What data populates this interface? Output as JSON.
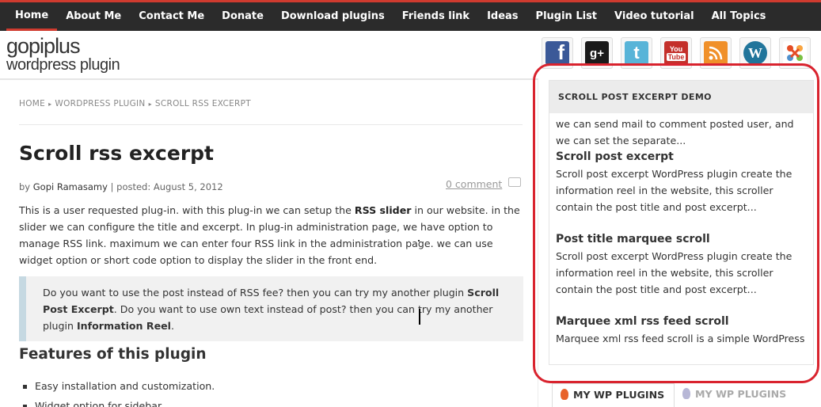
{
  "nav": {
    "items": [
      "Home",
      "About Me",
      "Contact Me",
      "Donate",
      "Download plugins",
      "Friends link",
      "Ideas",
      "Plugin List",
      "Video tutorial",
      "All Topics"
    ]
  },
  "logo": {
    "line1": "gopiplus",
    "line2": "wordpress plugin"
  },
  "social": {
    "icons": [
      "facebook-icon",
      "google-plus-icon",
      "twitter-icon",
      "youtube-icon",
      "rss-icon",
      "wordpress-icon",
      "joomla-icon"
    ],
    "glyphs": {
      "facebook": "f",
      "google": "g+",
      "twitter": "t",
      "youtube_top": "You",
      "youtube_bottom": "Tube",
      "wordpress": "W"
    }
  },
  "breadcrumb": {
    "home": "HOME",
    "section": "WORDPRESS PLUGIN",
    "current": "SCROLL RSS EXCERPT"
  },
  "post": {
    "title": "Scroll rss excerpt",
    "by": "by",
    "author": "Gopi Ramasamy",
    "posted": "| posted: August 5, 2012",
    "comments": "0 comment",
    "p1_a": "This is a user requested plug-in. with this plug-in we can setup the ",
    "p1_b": "RSS slider",
    "p1_c": " in our website. in the slider we can configure the title and excerpt. In plug-in administration page, we have option to manage RSS link. maximum we can enter four RSS link in the administration page. we can use widget option or short code option to display the slider in the front end.",
    "q_a": "Do you want to use the post instead of RSS fee? then you can try my another plugin ",
    "q_b": "Scroll Post Excerpt",
    "q_c": ". Do you want to use own text instead of post? then you can try my another plugin ",
    "q_d": "Information Reel",
    "q_e": ".",
    "features_title": "Features of this plugin",
    "features": [
      "Easy installation and customization.",
      "Widget option for sidebar."
    ]
  },
  "widget": {
    "title": "SCROLL POST EXCERPT DEMO",
    "lead_text": "we can send mail to comment posted user, and we can set the separate...",
    "items": [
      {
        "title": "Scroll post excerpt",
        "text": "Scroll post excerpt WordPress plugin create the information reel in the website, this scroller contain the post title and post excerpt..."
      },
      {
        "title": "Post title marquee scroll",
        "text": "Scroll post excerpt WordPress plugin create the information reel in the website, this scroller contain the post title and post excerpt..."
      },
      {
        "title": "Marquee xml rss feed scroll",
        "text": "Marquee xml rss feed scroll is a simple WordPress"
      }
    ]
  },
  "tabs": {
    "tab1": "MY WP PLUGINS",
    "tab2": "MY WP PLUGINS"
  },
  "colors": {
    "accent": "#cf3b2f",
    "highlight_ring": "#d9232e",
    "topbar": "#2b2b2b"
  }
}
